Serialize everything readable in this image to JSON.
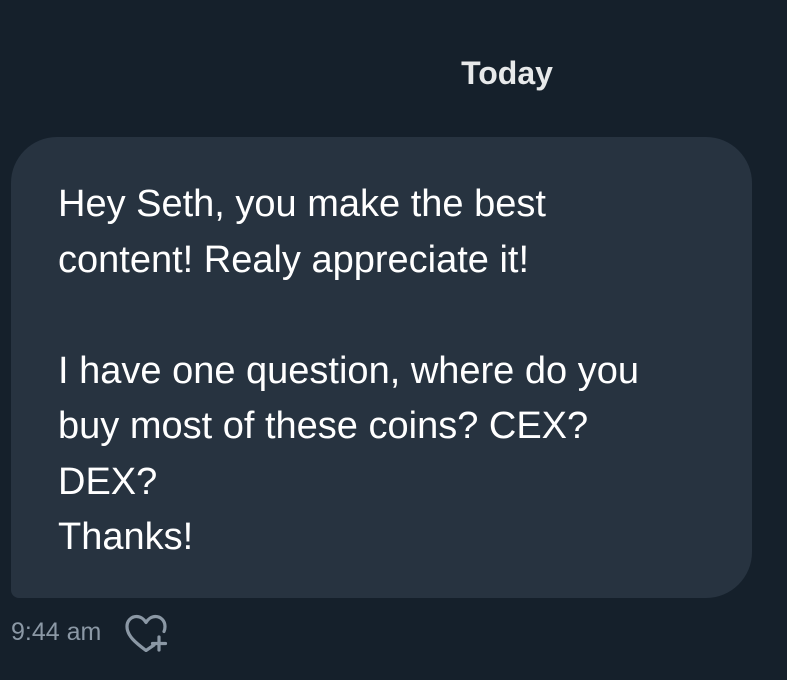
{
  "conversation": {
    "date_separator": "Today"
  },
  "message": {
    "lines": [
      "Hey Seth, you make the best",
      "content! Realy appreciate it!",
      "",
      "I have one question, where do you",
      "buy most of these coins? CEX?",
      "DEX?",
      "Thanks!"
    ],
    "timestamp": "9:44 am",
    "reaction_icon": "heart-plus-icon"
  },
  "colors": {
    "background": "#15202b",
    "bubble": "#273340",
    "text": "#ffffff",
    "muted": "#8b98a5"
  }
}
